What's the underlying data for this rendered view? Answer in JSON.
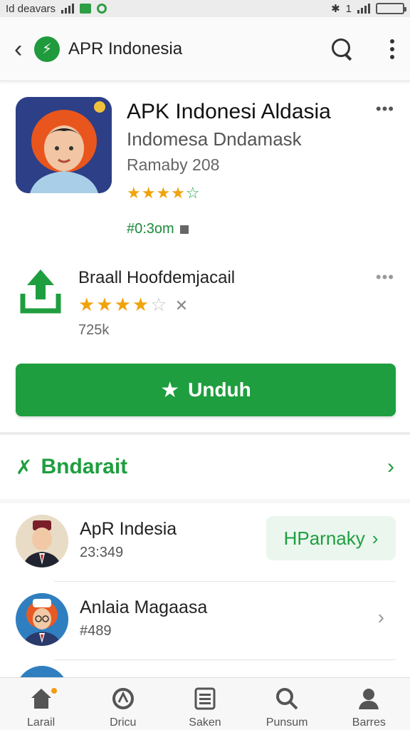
{
  "status_bar": {
    "left_text": "Id deavars",
    "right_text": "1"
  },
  "app_bar": {
    "title": "APR Indonesia",
    "back_icon": "back-arrow-icon",
    "logo_icon": "green-leaf-logo-icon",
    "search_icon": "search-icon",
    "menu_icon": "kebab-menu-icon"
  },
  "app": {
    "name": "APK Indonesi Aldasia",
    "subtitle": "Indomesa Dndamask",
    "meta": "Ramaby  208",
    "rating_stars": 3.5,
    "size": "#0:3om",
    "more_label": "•••"
  },
  "secondary": {
    "title": "Braall Hoofdemjacail",
    "rating_stars": 4,
    "count": "725k",
    "more_label": "•••"
  },
  "install_button": {
    "label": "Unduh",
    "icon": "star-icon"
  },
  "section": {
    "title": "Bndarait",
    "icon": "shuffle-icon",
    "chevron": "›"
  },
  "list": {
    "items": [
      {
        "name": "ApR Indesia",
        "sub": "23:349",
        "action_label": "Parnaky",
        "action_prefix": "H",
        "chevron": "›"
      },
      {
        "name": "Anlaia Magaasa",
        "sub": "#489",
        "chevron": "›"
      }
    ]
  },
  "bottom_nav": {
    "items": [
      {
        "label": "Larail",
        "icon": "home-icon"
      },
      {
        "label": "Dricu",
        "icon": "apps-icon"
      },
      {
        "label": "Saken",
        "icon": "list-icon"
      },
      {
        "label": "Punsum",
        "icon": "search-icon"
      },
      {
        "label": "Barres",
        "icon": "person-icon"
      }
    ]
  },
  "colors": {
    "accent": "#1f9e3f",
    "star": "#f0a30a",
    "icon_bg": "#2d3f86"
  }
}
